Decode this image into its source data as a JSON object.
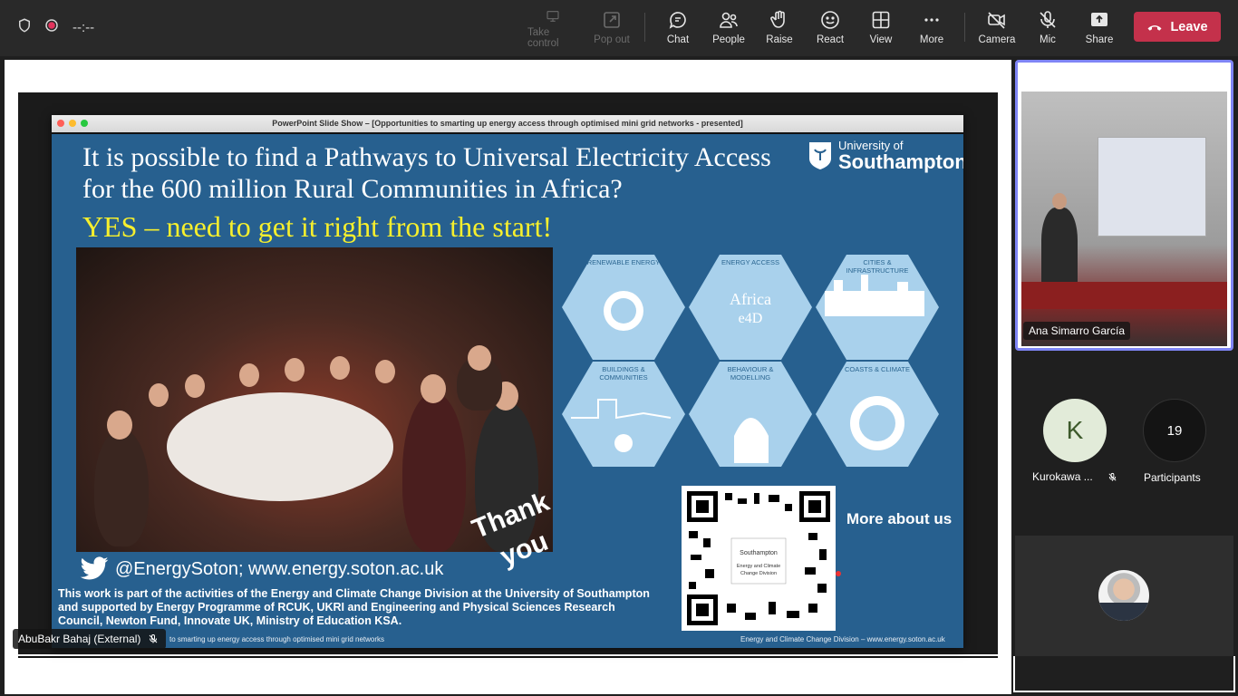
{
  "topbar": {
    "timer": "--:--",
    "buttons": {
      "take_control": "Take control",
      "pop_out": "Pop out",
      "chat": "Chat",
      "people": "People",
      "raise": "Raise",
      "react": "React",
      "view": "View",
      "more": "More",
      "camera": "Camera",
      "mic": "Mic",
      "share": "Share",
      "leave": "Leave"
    },
    "leave_color": "#c4314b"
  },
  "shared_screen": {
    "window_title": "PowerPoint Slide Show – [Opportunities to smarting up energy access through optimised mini grid networks - presented]",
    "slide": {
      "title": "It is possible to find a Pathways to Universal Electricity Access for the 600 million Rural Communities in Africa?",
      "subtitle": "YES – need to get it right from the start!",
      "logo_line1": "University of",
      "logo_line2": "Southampton",
      "hexagons": [
        {
          "label": "RENEWABLE ENERGY"
        },
        {
          "label": "ENERGY ACCESS"
        },
        {
          "label": "CITIES & INFRASTRUCTURE"
        },
        {
          "label": "BUILDINGS & COMMUNITIES"
        },
        {
          "label": "BEHAVIOUR & MODELLING"
        },
        {
          "label": "COASTS & CLIMATE"
        }
      ],
      "thank_you_line1": "Thank",
      "thank_you_line2": "you",
      "twitter": "@EnergySoton; www.energy.soton.ac.uk",
      "footer_text": "This work is part of the activities of the Energy and Climate Change Division at the University of Southampton  and supported by Energy Programme of RCUK, UKRI and Engineering and Physical Sciences Research Council, Newton Fund, Innovate UK, Ministry of Education KSA.",
      "more_about": "More about us",
      "foot_left": "to smarting up energy access through optimised mini grid networks",
      "foot_right": "Energy and Climate Change Division – www.energy.soton.ac.uk",
      "accent_title_color": "#f6ef2d",
      "background_color": "#27608f"
    },
    "presenter_tag": "AbuBakr Bahaj (External)"
  },
  "sidebar": {
    "active_video_name": "Ana Simarro García",
    "participant_k": {
      "initial": "K",
      "name": "Kurokawa ..."
    },
    "participants_count": "19",
    "participants_label": "Participants"
  }
}
